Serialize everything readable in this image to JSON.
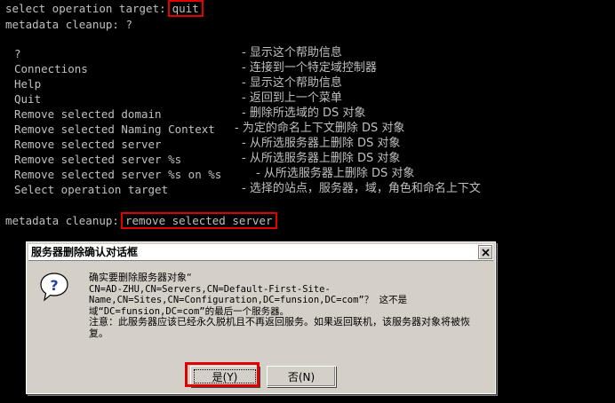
{
  "console": {
    "prompt1_prefix": "select operation target:",
    "prompt1_cmd": "quit",
    "prompt2": "metadata cleanup: ?",
    "help": [
      {
        "name": "?",
        "desc": "- 显示这个帮助信息"
      },
      {
        "name": "Connections",
        "desc": "- 连接到一个特定域控制器"
      },
      {
        "name": "Help",
        "desc": "- 显示这个帮助信息"
      },
      {
        "name": "Quit",
        "desc": "- 返回到上一个菜单"
      },
      {
        "name": "Remove selected domain",
        "desc": "- 删除所选域的 DS 对象"
      },
      {
        "name": "Remove selected Naming Context",
        "desc": "- 为定的命名上下文删除 DS 对象"
      },
      {
        "name": "Remove selected server",
        "desc": "- 从所选服务器上删除 DS 对象"
      },
      {
        "name": "Remove selected server %s",
        "desc": "- 从所选服务器上删除 DS 对象"
      },
      {
        "name": "Remove selected server %s on %s",
        "desc": "- 从所选服务器上删除 DS 对象"
      },
      {
        "name": "Select operation target",
        "desc": "- 选择的站点，服务器，域，角色和命名上下文"
      }
    ],
    "prompt3_prefix": "metadata cleanup:",
    "prompt3_cmd": "remove selected server"
  },
  "dialog": {
    "title": "服务器删除确认对话框",
    "close_glyph": "×",
    "icon": "question-icon",
    "line1": "确实要删除服务器对象“",
    "line2": "CN=AD-ZHU,CN=Servers,CN=Default-First-Site-Name,CN=Sites,CN=Configuration,DC=funsion,DC=com”？ 这不是域“DC=funsion,DC=com”的最后一个服务器。",
    "line3": "注意：此服务器应该已经永久脱机且不再返回服务。如果返回联机，该服务器对象将被恢复。",
    "yes_label": "是(Y)",
    "no_label": "否(N)"
  },
  "colors": {
    "console_bg": "#000000",
    "console_text": "#c0c0c0",
    "highlight": "#e00000",
    "dialog_bg": "#d4d0c8"
  }
}
